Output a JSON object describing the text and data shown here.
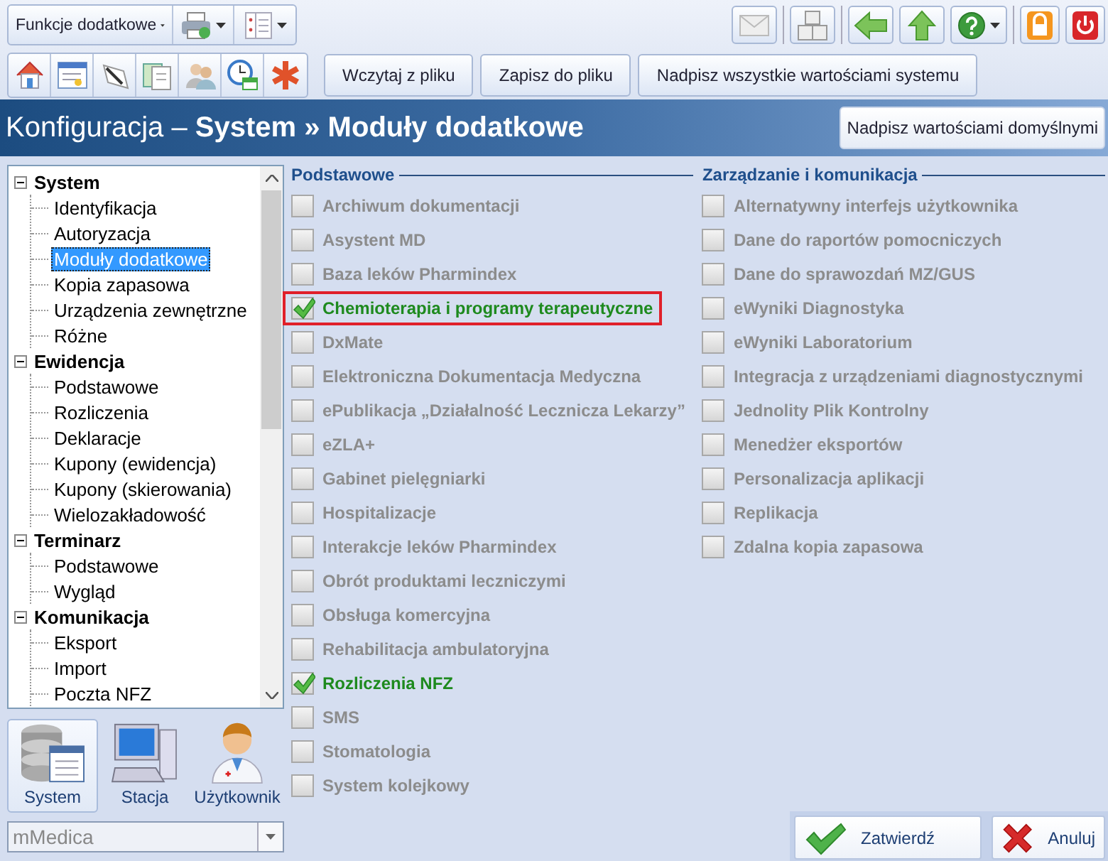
{
  "toolbar": {
    "functions_dropdown": "Funkcje dodatkowe",
    "action_buttons": [
      "Wczytaj z pliku",
      "Zapisz do pliku",
      "Nadpisz wszystkie wartościami systemu"
    ]
  },
  "header": {
    "title": "Konfiguracja – **System » Moduły dodatkowe**",
    "button": "Nadpisz wartościami domyślnymi"
  },
  "tree": [
    {
      "label": "System",
      "selected": false,
      "expanded": true,
      "children": [
        {
          "label": "Identyfikacja",
          "selected": false
        },
        {
          "label": "Autoryzacja",
          "selected": false
        },
        {
          "label": "Moduły dodatkowe",
          "selected": true
        },
        {
          "label": "Kopia zapasowa",
          "selected": false
        },
        {
          "label": "Urządzenia zewnętrzne",
          "selected": false
        },
        {
          "label": "Różne",
          "selected": false
        }
      ]
    },
    {
      "label": "Ewidencja",
      "selected": false,
      "expanded": true,
      "children": [
        {
          "label": "Podstawowe",
          "selected": false
        },
        {
          "label": "Rozliczenia",
          "selected": false
        },
        {
          "label": "Deklaracje",
          "selected": false
        },
        {
          "label": "Kupony (ewidencja)",
          "selected": false
        },
        {
          "label": "Kupony (skierowania)",
          "selected": false
        },
        {
          "label": "Wielozakładowość",
          "selected": false
        }
      ]
    },
    {
      "label": "Terminarz",
      "selected": false,
      "expanded": true,
      "children": [
        {
          "label": "Podstawowe",
          "selected": false
        },
        {
          "label": "Wygląd",
          "selected": false
        }
      ]
    },
    {
      "label": "Komunikacja",
      "selected": false,
      "expanded": true,
      "children": [
        {
          "label": "Eksport",
          "selected": false
        },
        {
          "label": "Import",
          "selected": false
        },
        {
          "label": "Poczta NFZ",
          "selected": false
        }
      ]
    }
  ],
  "nav": [
    {
      "label": "System",
      "kind": "system",
      "selected": true
    },
    {
      "label": "Stacja",
      "kind": "station",
      "selected": false
    },
    {
      "label": "Użytkownik",
      "kind": "user",
      "selected": false
    }
  ],
  "profile_combo": {
    "value": "mMedica"
  },
  "sections": [
    {
      "title": "Podstawowe",
      "modules": [
        {
          "label": "Archiwum dokumentacji",
          "checked": false,
          "highlighted": false
        },
        {
          "label": "Asystent MD",
          "checked": false,
          "highlighted": false
        },
        {
          "label": "Baza leków Pharmindex",
          "checked": false,
          "highlighted": false
        },
        {
          "label": "Chemioterapia i programy terapeutyczne",
          "checked": true,
          "highlighted": true
        },
        {
          "label": "DxMate",
          "checked": false,
          "highlighted": false
        },
        {
          "label": "Elektroniczna Dokumentacja Medyczna",
          "checked": false,
          "highlighted": false
        },
        {
          "label": "ePublikacja „Działalność Lecznicza Lekarzy”",
          "checked": false,
          "highlighted": false
        },
        {
          "label": "eZLA+",
          "checked": false,
          "highlighted": false
        },
        {
          "label": "Gabinet pielęgniarki",
          "checked": false,
          "highlighted": false
        },
        {
          "label": "Hospitalizacje",
          "checked": false,
          "highlighted": false
        },
        {
          "label": "Interakcje leków Pharmindex",
          "checked": false,
          "highlighted": false
        },
        {
          "label": "Obrót produktami leczniczymi",
          "checked": false,
          "highlighted": false
        },
        {
          "label": "Obsługa komercyjna",
          "checked": false,
          "highlighted": false
        },
        {
          "label": "Rehabilitacja ambulatoryjna",
          "checked": false,
          "highlighted": false
        },
        {
          "label": "Rozliczenia NFZ",
          "checked": true,
          "highlighted": false
        },
        {
          "label": "SMS",
          "checked": false,
          "highlighted": false
        },
        {
          "label": "Stomatologia",
          "checked": false,
          "highlighted": false
        },
        {
          "label": "System kolejkowy",
          "checked": false,
          "highlighted": false
        }
      ]
    },
    {
      "title": "Zarządzanie i komunikacja",
      "modules": [
        {
          "label": "Alternatywny interfejs użytkownika",
          "checked": false,
          "highlighted": false
        },
        {
          "label": "Dane do raportów pomocniczych",
          "checked": false,
          "highlighted": false
        },
        {
          "label": "Dane do sprawozdań MZ/GUS",
          "checked": false,
          "highlighted": false
        },
        {
          "label": "eWyniki Diagnostyka",
          "checked": false,
          "highlighted": false
        },
        {
          "label": "eWyniki Laboratorium",
          "checked": false,
          "highlighted": false
        },
        {
          "label": "Integracja z urządzeniami diagnostycznymi",
          "checked": false,
          "highlighted": false
        },
        {
          "label": "Jednolity Plik Kontrolny",
          "checked": false,
          "highlighted": false
        },
        {
          "label": "Menedżer eksportów",
          "checked": false,
          "highlighted": false
        },
        {
          "label": "Personalizacja aplikacji",
          "checked": false,
          "highlighted": false
        },
        {
          "label": "Replikacja",
          "checked": false,
          "highlighted": false
        },
        {
          "label": "Zdalna kopia zapasowa",
          "checked": false,
          "highlighted": false
        }
      ]
    }
  ],
  "footer_buttons": [
    {
      "label": "Zatwierdź",
      "kind": "confirm"
    },
    {
      "label": "Anuluj",
      "kind": "cancel"
    }
  ]
}
